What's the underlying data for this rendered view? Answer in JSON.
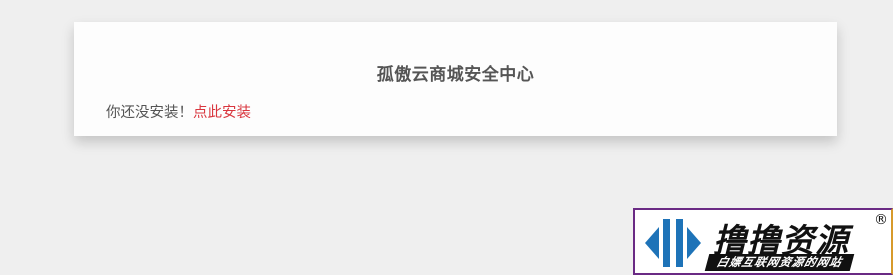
{
  "card": {
    "title": "孤傲云商城安全中心",
    "message_prefix": "你还没安装！",
    "install_link": "点此安装"
  },
  "watermark": {
    "name": "撸撸资源",
    "registered_mark": "®",
    "tagline": "白嫖互联网资源的网站"
  },
  "colors": {
    "background": "#efefef",
    "card": "#fdfdfd",
    "text": "#555555",
    "link": "#d9363e",
    "logo_blue": "#1e73b8"
  }
}
